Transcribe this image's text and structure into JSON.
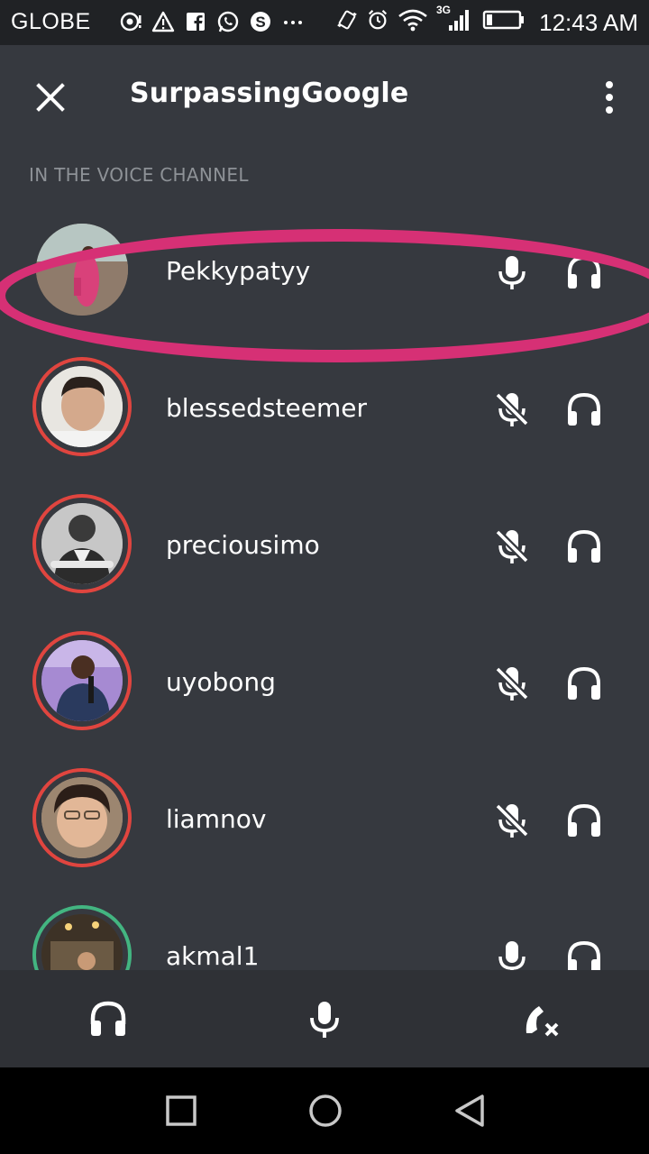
{
  "status_bar": {
    "carrier": "GLOBE",
    "time": "12:43 AM",
    "network_label": "3G",
    "icons_left": [
      "tether-icon",
      "warning-icon",
      "facebook-icon",
      "whatsapp-icon",
      "skype-icon",
      "more-dots-icon"
    ],
    "icons_right": [
      "vibrate-icon",
      "alarm-icon",
      "wifi-icon",
      "signal-icon",
      "battery-icon"
    ]
  },
  "header": {
    "title": "SurpassingGoogle",
    "close_icon": "close-icon",
    "menu_icon": "more-vertical-icon"
  },
  "section": {
    "label": "IN THE VOICE CHANNEL"
  },
  "members": [
    {
      "name": "Pekkypatyy",
      "muted": false,
      "ring": "none",
      "highlighted": true
    },
    {
      "name": "blessedsteemer",
      "muted": true,
      "ring": "#e0453f",
      "highlighted": false
    },
    {
      "name": "preciousimo",
      "muted": true,
      "ring": "#e0453f",
      "highlighted": false
    },
    {
      "name": "uyobong",
      "muted": true,
      "ring": "#e0453f",
      "highlighted": false
    },
    {
      "name": "liamnov",
      "muted": true,
      "ring": "#e0453f",
      "highlighted": false
    },
    {
      "name": "akmal1",
      "muted": false,
      "ring": "#43b581",
      "highlighted": false
    }
  ],
  "controls": {
    "items": [
      "headset-icon",
      "microphone-icon",
      "disconnect-call-icon"
    ]
  },
  "nav": {
    "items": [
      "recents-square-icon",
      "home-circle-icon",
      "back-triangle-icon"
    ]
  },
  "colors": {
    "background": "#36393f",
    "status_bar": "#202225",
    "controls_bar": "#2f3136",
    "muted_ring": "#e0453f",
    "speaking_ring": "#43b581",
    "highlight": "#d63075",
    "section_label": "#8e9297"
  }
}
